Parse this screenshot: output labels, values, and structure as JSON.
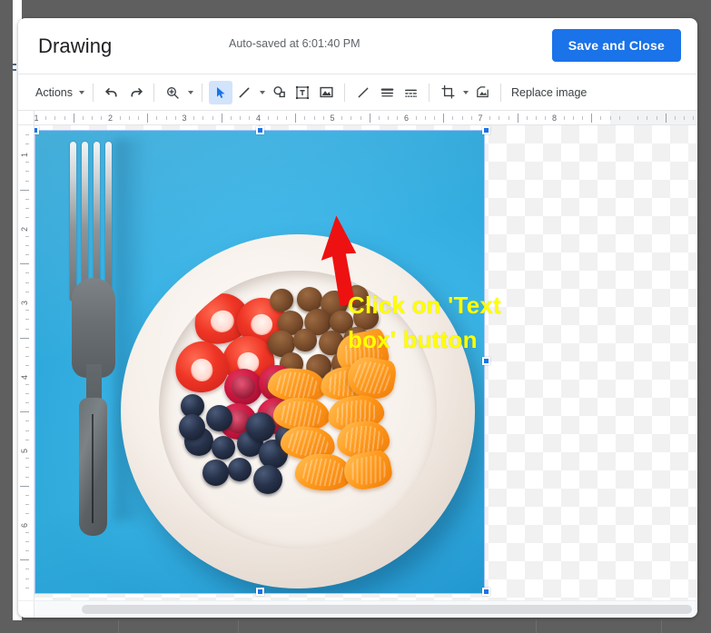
{
  "window": {
    "overlay_color": "#5f5f5f",
    "dialog_bg": "#ffffff"
  },
  "header": {
    "title": "Drawing",
    "autosave_status": "Auto-saved at 6:01:40 PM",
    "save_button": "Save and Close",
    "accent_color": "#1a73e8"
  },
  "toolbar": {
    "actions_label": "Actions",
    "replace_image_label": "Replace image",
    "items": [
      {
        "name": "actions-menu",
        "label": "Actions",
        "type": "menu"
      },
      {
        "name": "undo-icon",
        "label": "Undo",
        "type": "icon"
      },
      {
        "name": "redo-icon",
        "label": "Redo",
        "type": "icon"
      },
      {
        "name": "zoom-icon",
        "label": "Zoom",
        "type": "icon-menu"
      },
      {
        "name": "select-icon",
        "label": "Select",
        "type": "icon",
        "active": true
      },
      {
        "name": "line-icon",
        "label": "Line",
        "type": "icon-menu"
      },
      {
        "name": "shape-icon",
        "label": "Shape",
        "type": "icon"
      },
      {
        "name": "text-box-icon",
        "label": "Text box",
        "type": "icon",
        "highlighted": true
      },
      {
        "name": "image-icon",
        "label": "Image",
        "type": "icon"
      },
      {
        "name": "fill-color-icon",
        "label": "Fill color",
        "type": "icon"
      },
      {
        "name": "line-weight-icon",
        "label": "Line weight",
        "type": "icon"
      },
      {
        "name": "line-dash-icon",
        "label": "Line dash",
        "type": "icon"
      },
      {
        "name": "crop-icon",
        "label": "Crop image",
        "type": "icon-menu"
      },
      {
        "name": "mask-image-icon",
        "label": "Mask image",
        "type": "icon"
      },
      {
        "name": "replace-image-button",
        "label": "Replace image",
        "type": "text-button"
      }
    ]
  },
  "rulers": {
    "horizontal_units": [
      "1",
      "2",
      "3",
      "4",
      "5",
      "6",
      "7",
      "8"
    ],
    "vertical_units": [
      "1",
      "2",
      "3",
      "4",
      "5",
      "6"
    ]
  },
  "canvas": {
    "selected_object": "image",
    "selection_color": "#1a73e8",
    "photo_description": "White bowl of fruit — strawberries, hazelnuts, raspberries, blueberries and mandarin segments — with a fork on a cyan background",
    "photo_bg_color": "#2fb7ef"
  },
  "annotation": {
    "caption_line1": "Click on 'Text",
    "caption_line2": "box' button",
    "caption_color": "#ffff00",
    "arrow_color": "#ee1111"
  },
  "scrollbar": {
    "name": "horizontal-scrollbar"
  }
}
